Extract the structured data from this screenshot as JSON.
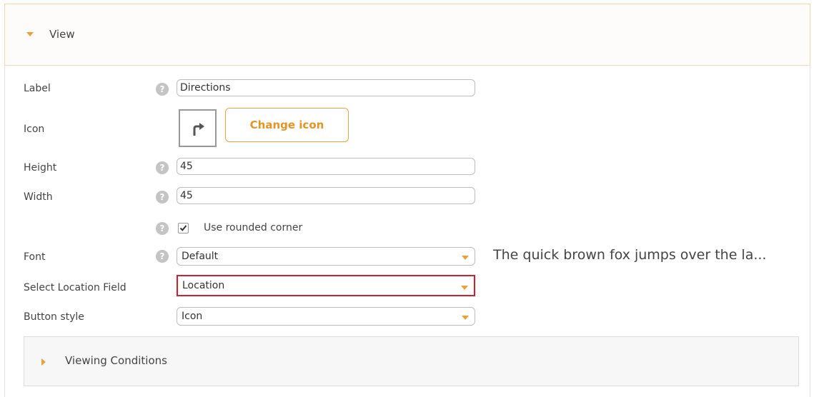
{
  "view_section": {
    "title": "View",
    "state": "expanded",
    "caret_icon": "caret-down-icon"
  },
  "form": {
    "label": {
      "label": "Label",
      "value": "Directions"
    },
    "icon": {
      "label": "Icon",
      "preview_icon": "turn-right-arrow-icon",
      "change_button": "Change icon"
    },
    "height": {
      "label": "Height",
      "value": "45"
    },
    "width": {
      "label": "Width",
      "value": "45"
    },
    "rounded_corner": {
      "label": "Use rounded corner",
      "checked": true
    },
    "font": {
      "label": "Font",
      "value": "Default",
      "preview_text": "The quick brown fox jumps over the la..."
    },
    "location_field": {
      "label": "Select Location Field",
      "value": "Location"
    },
    "button_style": {
      "label": "Button style",
      "value": "Icon"
    },
    "help_glyph": "?"
  },
  "viewing_conditions": {
    "title": "Viewing Conditions",
    "state": "collapsed",
    "caret_icon": "caret-right-icon"
  },
  "colors": {
    "accent": "#e8a23a",
    "highlight_border": "#c8232f",
    "help_icon": "#c4c4c4"
  }
}
